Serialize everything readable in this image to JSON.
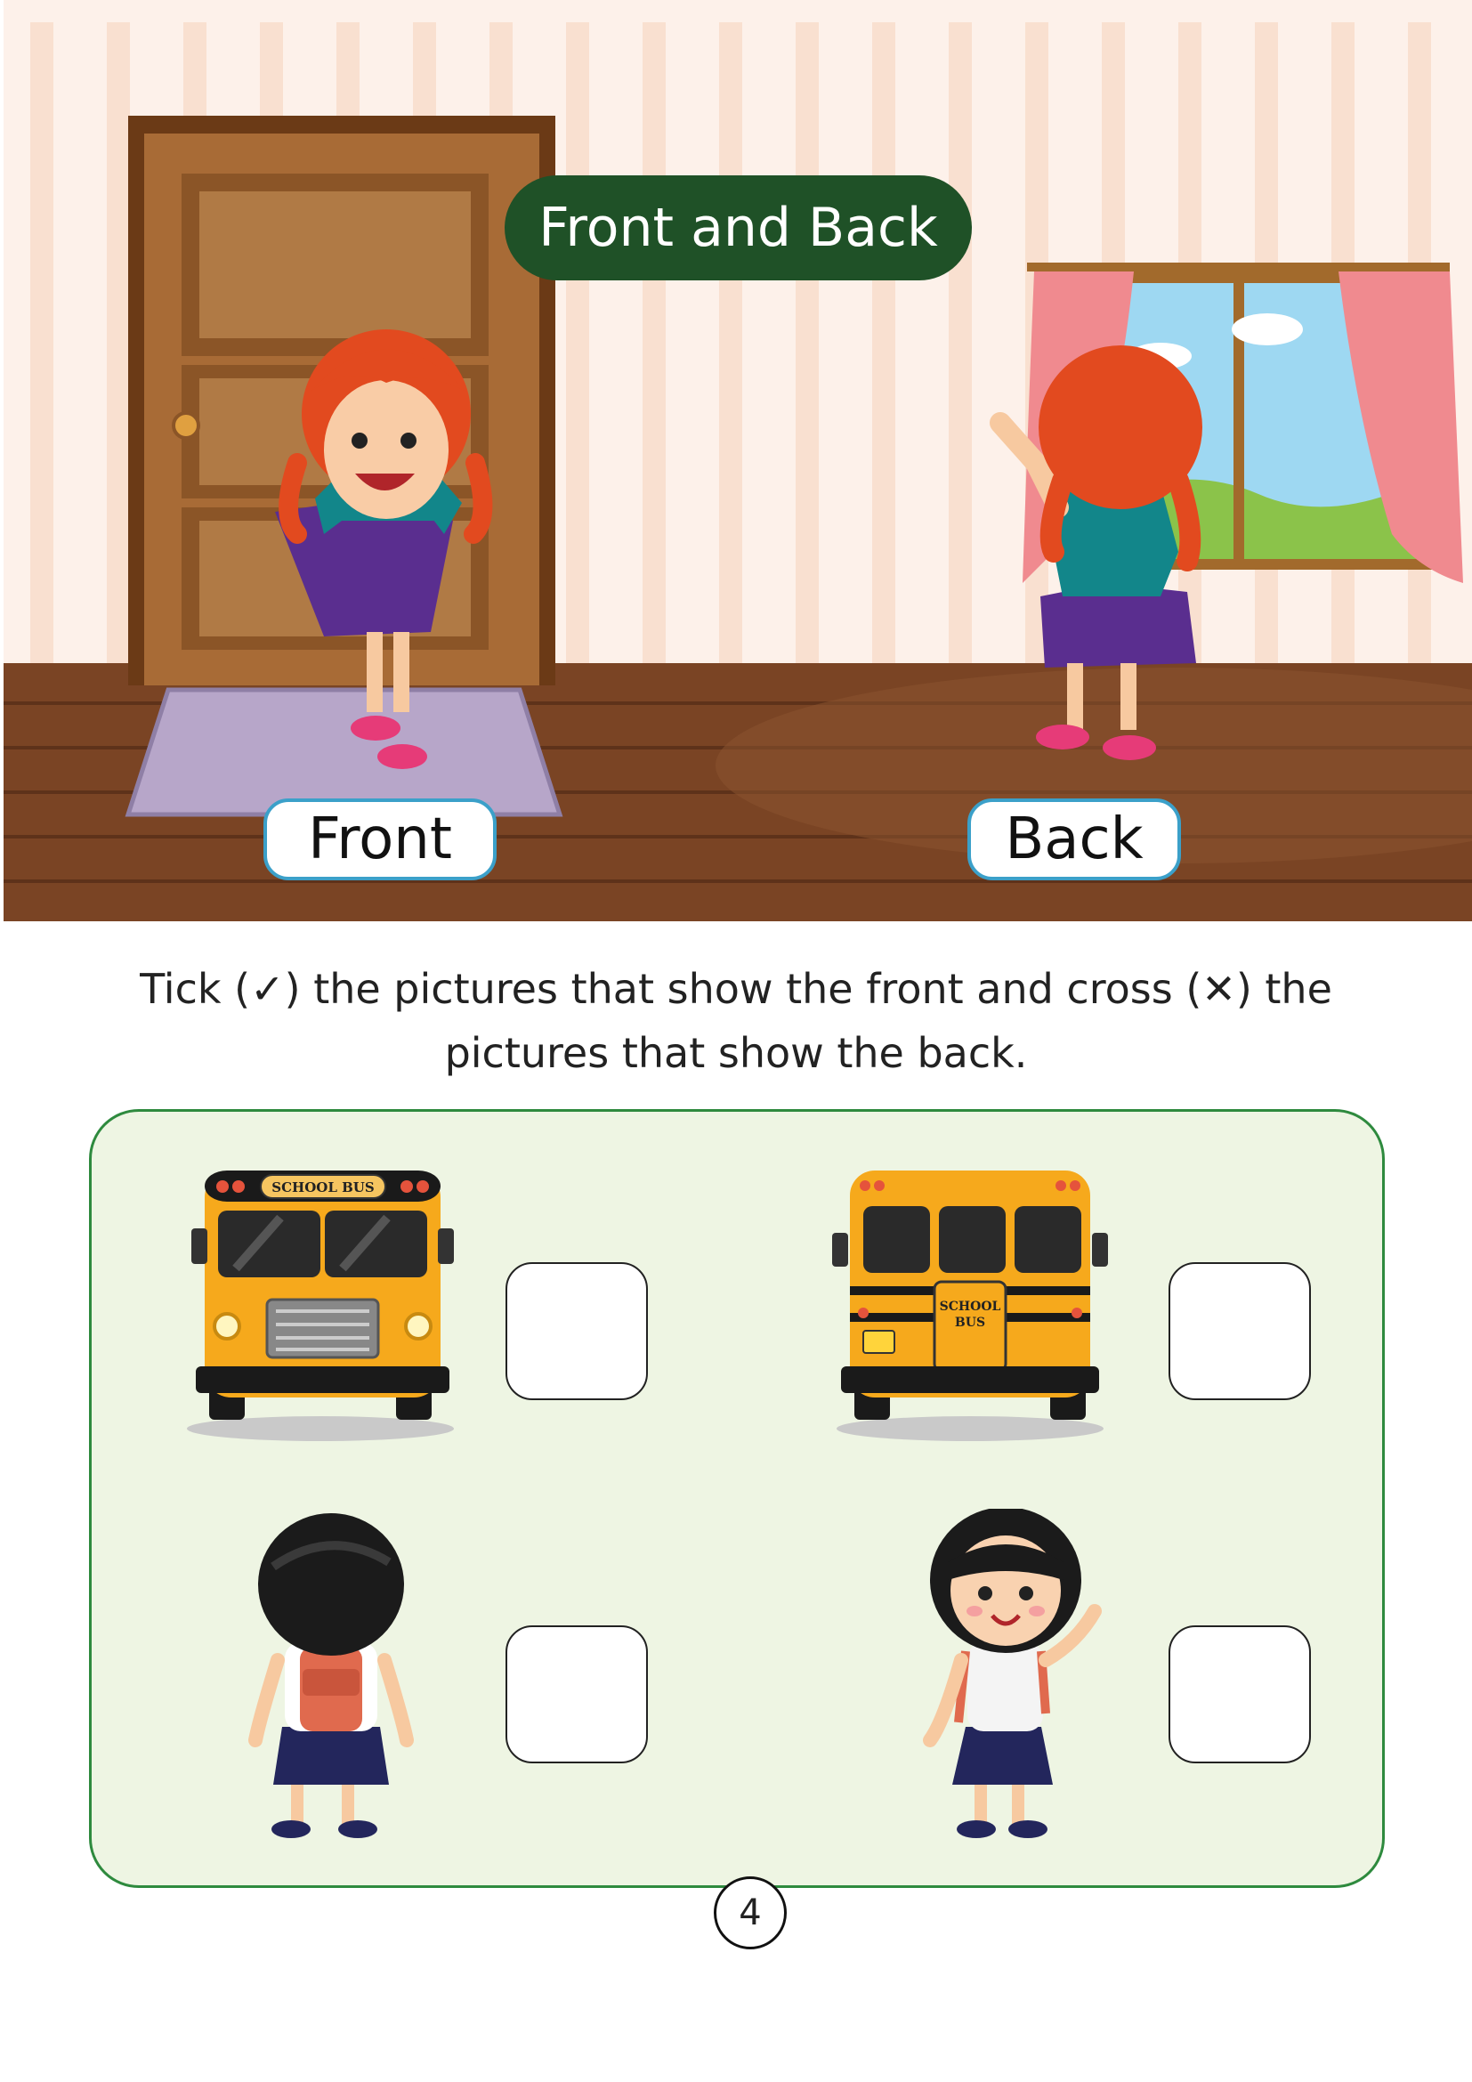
{
  "header": {
    "title": "Front and Back"
  },
  "scene": {
    "front_label": "Front",
    "back_label": "Back"
  },
  "instruction": {
    "line1": "Tick (✓) the pictures that show the front and cross (✕) the",
    "line2": "pictures that show the back."
  },
  "items": [
    {
      "name": "school-bus-front",
      "sign": "SCHOOL BUS",
      "answer": ""
    },
    {
      "name": "school-bus-back",
      "sign_line1": "SCHOOL",
      "sign_line2": "BUS",
      "answer": ""
    },
    {
      "name": "girl-back",
      "answer": ""
    },
    {
      "name": "girl-front",
      "answer": ""
    }
  ],
  "footer": {
    "page_number": "4"
  },
  "colors": {
    "title_bg": "#1f5127",
    "panel_bg": "#eef5e3",
    "panel_border": "#2e8a3e",
    "pill_border": "#3ba0c9"
  }
}
